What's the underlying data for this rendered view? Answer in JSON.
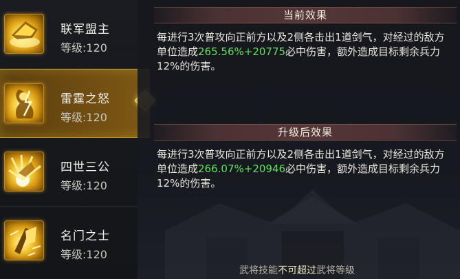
{
  "skills": [
    {
      "name": "联军盟主",
      "level": "等级:120",
      "icon": "golden-banner-icon",
      "selected": false
    },
    {
      "name": "雷霆之怒",
      "level": "等级:120",
      "icon": "thunder-warrior-icon",
      "selected": true
    },
    {
      "name": "四世三公",
      "level": "等级:120",
      "icon": "golden-burst-icon",
      "selected": false
    },
    {
      "name": "名门之士",
      "level": "等级:120",
      "icon": "golden-scroll-icon",
      "selected": false
    }
  ],
  "current": {
    "title": "当前效果",
    "desc_pre": "每进行3次普攻向正前方以及2侧各击出1道剑气，对经过的敌方单位造成",
    "desc_value": "265.56%+20775",
    "desc_post": "必中伤害，额外造成目标剩余兵力12%的伤害。"
  },
  "upgrade": {
    "title": "升级后效果",
    "desc_pre": "每进行3次普攻向正前方以及2侧各击出1道剑气，对经过的敌方单位造成",
    "desc_value": "266.07%+20946",
    "desc_post": "必中伤害，额外造成目标剩余兵力12%的伤害。"
  },
  "footer": {
    "part1": "武将技能",
    "part2": "不可超过",
    "part3": "武将等级"
  },
  "colors": {
    "highlight": "#5fe35a",
    "selected_gold": "#c89a2a",
    "header_band": "#643e3e"
  }
}
